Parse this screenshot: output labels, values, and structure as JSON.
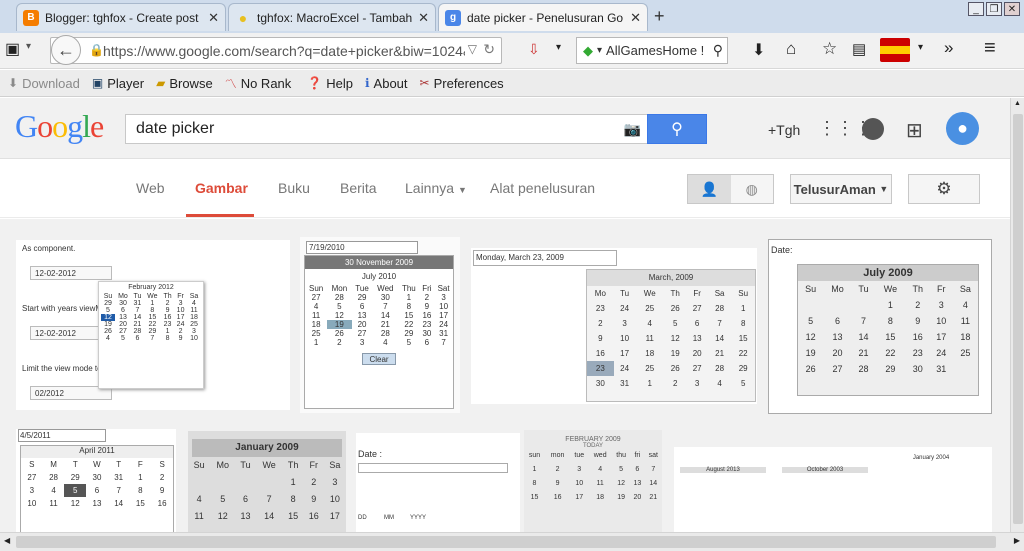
{
  "tabs": [
    {
      "title": "Blogger: tghfox - Create post",
      "icon": "blogger-icon",
      "color": "#f57d00"
    },
    {
      "title": "tghfox: MacroExcel - Tambah...",
      "icon": "bulb-icon",
      "color": "#e8c020"
    },
    {
      "title": "date picker - Penelusuran Go...",
      "icon": "google-icon",
      "color": "#4a86e8"
    }
  ],
  "address": {
    "url": "https://www.google.com/search?q=date+picker&biw=1024&b"
  },
  "search_bar": {
    "value": "AllGamesHome !"
  },
  "bookmarks": [
    {
      "label": "Download",
      "icon": "download-icon"
    },
    {
      "label": "Player",
      "icon": "player-icon"
    },
    {
      "label": "Browse",
      "icon": "folder-icon"
    },
    {
      "label": "No Rank",
      "icon": "rank-icon"
    },
    {
      "label": "Help",
      "icon": "help-icon"
    },
    {
      "label": "About",
      "icon": "info-icon"
    },
    {
      "label": "Preferences",
      "icon": "tools-icon"
    }
  ],
  "google": {
    "logo": "Google",
    "query": "date picker",
    "plus_label": "+Tgh",
    "tabs": [
      "Web",
      "Gambar",
      "Buku",
      "Berita",
      "Lainnya",
      "Alat penelusuran"
    ],
    "safe_search": "TelusurAman"
  },
  "thumbs": {
    "t1": {
      "l1": "As component.",
      "l2": "Start with years viewMode",
      "l3": "Limit the view mode to m",
      "f1": "12-02-2012",
      "f2": "12-02-2012",
      "f3": "02/2012",
      "month": "February 2012"
    },
    "t2": {
      "field": "7/19/2010",
      "banner": "30 November 2009",
      "month": "July 2010",
      "clear": "Clear"
    },
    "t3": {
      "field": "Monday, March 23, 2009",
      "month": "March, 2009"
    },
    "t4": {
      "label": "Date:",
      "month": "July 2009"
    },
    "t5": {
      "field": "4/5/2011",
      "month": "April 2011"
    },
    "t6": {
      "month": "January 2009"
    },
    "t7": {
      "label": "Date :",
      "mm": "MM",
      "dd": "DD",
      "yy": "YYYY"
    },
    "t8": {
      "month": "FEBRUARY 2009",
      "today": "TODAY"
    },
    "t9": {
      "m1": "August 2013",
      "m2": "October 2003",
      "m3": "January 2004"
    }
  }
}
